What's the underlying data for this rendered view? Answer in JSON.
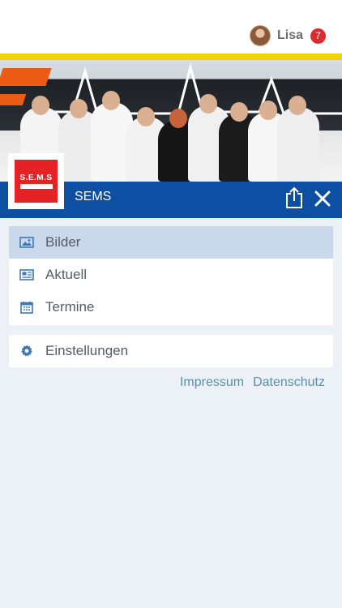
{
  "header": {
    "user_name": "Lisa",
    "notification_count": "7",
    "avatar_icon": "user-avatar"
  },
  "banner": {
    "logo_text": "S.E.M.S",
    "title": "SEMS"
  },
  "menu": {
    "items": [
      {
        "label": "Bilder",
        "icon": "image-icon",
        "active": true
      },
      {
        "label": "Aktuell",
        "icon": "news-icon",
        "active": false
      },
      {
        "label": "Termine",
        "icon": "calendar-icon",
        "active": false
      }
    ],
    "settings": {
      "label": "Einstellungen",
      "icon": "gear-icon"
    }
  },
  "footer": {
    "impressum": "Impressum",
    "datenschutz": "Datenschutz"
  },
  "colors": {
    "brand_blue": "#0d4fa3",
    "active_row": "#c9d8ea",
    "badge_red": "#dd2b2b",
    "link": "#5c8ea8",
    "icon_blue": "#3d78b4",
    "background": "#ecf1f8"
  }
}
